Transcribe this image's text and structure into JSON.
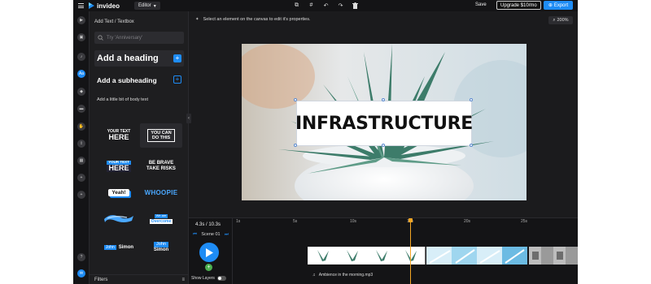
{
  "topbar": {
    "app_name": "invideo",
    "mode_dropdown": "Editor",
    "save_label": "Save",
    "upgrade_label": "Upgrade $10/mo",
    "export_label": "Export",
    "icons": [
      "layers-icon",
      "grid-icon",
      "undo-icon",
      "redo-icon",
      "delete-icon"
    ]
  },
  "rail": {
    "items": [
      "video-icon",
      "image-icon",
      "music-icon",
      "text-icon",
      "shapes-icon",
      "folder-icon",
      "brand-icon",
      "upload-icon",
      "template-icon",
      "add-icon",
      "plus-icon",
      "help-icon",
      "chat-icon"
    ],
    "active": "text-icon"
  },
  "panel": {
    "title": "Add Text / Textbox",
    "search_placeholder": "Try 'Anniversary'",
    "heading_label": "Add a heading",
    "subheading_label": "Add a subheading",
    "body_label": "Add a little bit of body text",
    "filters_label": "Filters",
    "presets": [
      {
        "lines": [
          "YOUR TEXT",
          "HERE"
        ]
      },
      {
        "lines": [
          "YOU CAN",
          "DO THIS"
        ]
      },
      {
        "lines": [
          "YOUR TEXT",
          "HERE"
        ]
      },
      {
        "lines": [
          "BE BRAVE",
          "TAKE RISKS"
        ]
      },
      {
        "lines": [
          "Yeah!"
        ]
      },
      {
        "lines": [
          "WHOOPIE"
        ]
      },
      {
        "lines": [
          ""
        ]
      },
      {
        "lines": [
          "We are",
          "Overcome"
        ]
      },
      {
        "lines": [
          "John",
          "Simon"
        ]
      },
      {
        "lines": [
          "John",
          "Simon"
        ]
      }
    ]
  },
  "editor": {
    "hint": "Select an element on the canvas to edit it's properties.",
    "zoom": "200%",
    "canvas_text": "INFRASTRUCTURE"
  },
  "timeline": {
    "time": "4.3s / 10.3s",
    "scene_label": "Scene 01",
    "ticks": [
      "1s",
      "5s",
      "10s",
      "15s",
      "20s",
      "25s"
    ],
    "show_layers_label": "Show Layers",
    "audio_label": "Ambience in the morning.mp3"
  },
  "colors": {
    "accent": "#1e8cf5",
    "playhead": "#f5a623",
    "add_scene": "#4caf50"
  }
}
